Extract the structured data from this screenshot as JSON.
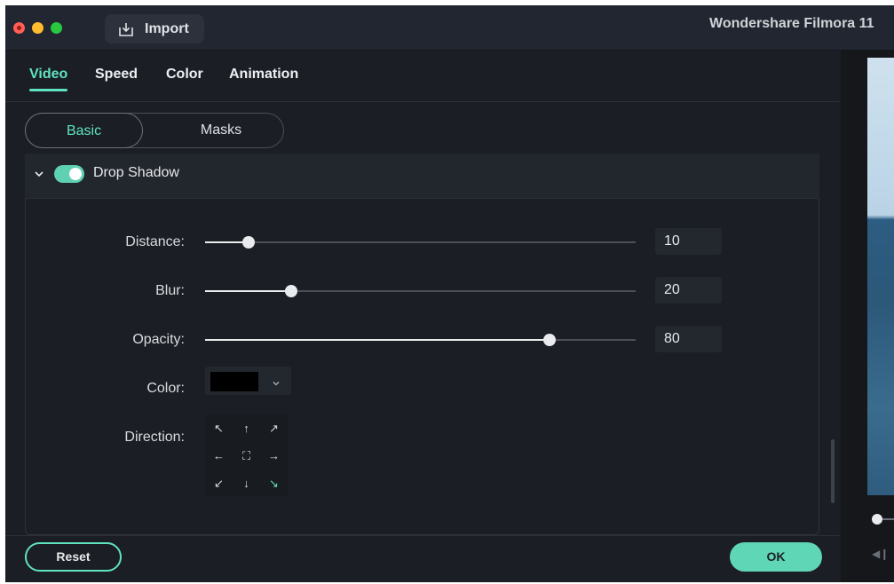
{
  "titlebar": {
    "import_label": "Import",
    "app_title": "Wondershare Filmora 11"
  },
  "tabs": [
    {
      "label": "Video",
      "active": true
    },
    {
      "label": "Speed",
      "active": false
    },
    {
      "label": "Color",
      "active": false
    },
    {
      "label": "Animation",
      "active": false
    }
  ],
  "segments": [
    {
      "label": "Basic",
      "active": true
    },
    {
      "label": "Masks",
      "active": false
    }
  ],
  "drop_shadow": {
    "title": "Drop Shadow",
    "enabled": true,
    "distance": {
      "label": "Distance:",
      "value": "10",
      "fraction": 0.1
    },
    "blur": {
      "label": "Blur:",
      "value": "20",
      "fraction": 0.2
    },
    "opacity": {
      "label": "Opacity:",
      "value": "80",
      "fraction": 0.8
    },
    "color": {
      "label": "Color:",
      "value": "#000000"
    },
    "direction": {
      "label": "Direction:",
      "glyphs": [
        "↖",
        "↑",
        "↗",
        "←",
        "⛶",
        "→",
        "↙",
        "↓",
        "↘"
      ],
      "selected": "↘"
    }
  },
  "footer": {
    "reset_label": "Reset",
    "ok_label": "OK"
  },
  "colors": {
    "accent": "#5fe3c2",
    "background": "#1b1e24"
  }
}
